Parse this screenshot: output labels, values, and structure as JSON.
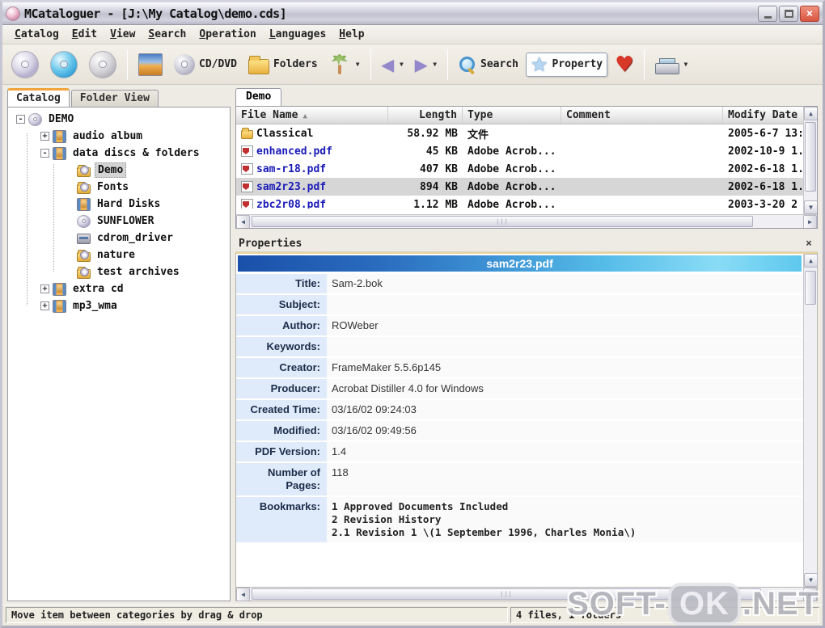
{
  "window": {
    "title": "MCataloguer - [J:\\My Catalog\\demo.cds]"
  },
  "menu": {
    "items": [
      "Catalog",
      "Edit",
      "View",
      "Search",
      "Operation",
      "Languages",
      "Help"
    ]
  },
  "toolbar": {
    "cd_dvd_label": "CD/DVD",
    "folders_label": "Folders",
    "search_label": "Search",
    "property_label": "Property"
  },
  "icons": {
    "dropdown": "▼",
    "back": "◀",
    "forward": "▶",
    "star": "★",
    "heart": "♥",
    "close": "×",
    "sort_ascending": "▲",
    "scroll_up": "▲",
    "scroll_down": "▼",
    "scroll_left": "◀",
    "scroll_right": "▶",
    "thumb_grip": "|||"
  },
  "left_panel": {
    "tabs": [
      {
        "label": "Catalog",
        "active": true
      },
      {
        "label": "Folder View",
        "active": false
      }
    ],
    "tree": [
      {
        "label": "DEMO",
        "level": 0,
        "expander": "-",
        "icon": "cd",
        "selected": false
      },
      {
        "label": "audio album",
        "level": 1,
        "expander": "+",
        "icon": "category",
        "selected": false
      },
      {
        "label": "data discs & folders",
        "level": 1,
        "expander": "-",
        "icon": "category",
        "selected": false
      },
      {
        "label": "Demo",
        "level": 2,
        "expander": "",
        "icon": "folderdisc",
        "selected": true
      },
      {
        "label": "Fonts",
        "level": 2,
        "expander": "",
        "icon": "folderdisc",
        "selected": false
      },
      {
        "label": "Hard Disks",
        "level": 2,
        "expander": "",
        "icon": "category",
        "selected": false
      },
      {
        "label": "SUNFLOWER",
        "level": 2,
        "expander": "",
        "icon": "cd",
        "selected": false
      },
      {
        "label": "cdrom_driver",
        "level": 2,
        "expander": "",
        "icon": "drive",
        "selected": false
      },
      {
        "label": "nature",
        "level": 2,
        "expander": "",
        "icon": "folderdisc",
        "selected": false
      },
      {
        "label": "test archives",
        "level": 2,
        "expander": "",
        "icon": "folderdisc",
        "selected": false
      },
      {
        "label": "extra cd",
        "level": 1,
        "expander": "+",
        "icon": "category",
        "selected": false
      },
      {
        "label": "mp3_wma",
        "level": 1,
        "expander": "+",
        "icon": "category",
        "selected": false
      }
    ]
  },
  "file_panel": {
    "tab": "Demo",
    "columns": [
      "File Name",
      "Length",
      "Type",
      "Comment",
      "Modify Date"
    ],
    "sorted_by": "File Name",
    "rows": [
      {
        "icon": "folder",
        "name": "Classical",
        "length": "58.92 MB",
        "type": "文件",
        "comment": "",
        "modify_date": "2005-6-7 13:",
        "selected": false
      },
      {
        "icon": "pdf",
        "name": "enhanced.pdf",
        "length": "45 KB",
        "type": "Adobe Acrob...",
        "comment": "",
        "modify_date": "2002-10-9 1.",
        "selected": false
      },
      {
        "icon": "pdf",
        "name": "sam-r18.pdf",
        "length": "407 KB",
        "type": "Adobe Acrob...",
        "comment": "",
        "modify_date": "2002-6-18 1.",
        "selected": false
      },
      {
        "icon": "pdf",
        "name": "sam2r23.pdf",
        "length": "894 KB",
        "type": "Adobe Acrob...",
        "comment": "",
        "modify_date": "2002-6-18 1.",
        "selected": true
      },
      {
        "icon": "pdf",
        "name": "zbc2r08.pdf",
        "length": "1.12 MB",
        "type": "Adobe Acrob...",
        "comment": "",
        "modify_date": "2003-3-20 2",
        "selected": false
      }
    ]
  },
  "properties_panel": {
    "title": "Properties",
    "banner": "sam2r23.pdf",
    "fields": [
      {
        "label": "Title:",
        "value": "Sam-2.bok",
        "mono": false
      },
      {
        "label": "Subject:",
        "value": "",
        "mono": false
      },
      {
        "label": "Author:",
        "value": "ROWeber",
        "mono": false
      },
      {
        "label": "Keywords:",
        "value": "",
        "mono": false
      },
      {
        "label": "Creator:",
        "value": "FrameMaker 5.5.6p145",
        "mono": false
      },
      {
        "label": "Producer:",
        "value": "Acrobat Distiller 4.0 for Windows",
        "mono": false
      },
      {
        "label": "Created Time:",
        "value": "03/16/02 09:24:03",
        "mono": false
      },
      {
        "label": "Modified:",
        "value": "03/16/02 09:49:56",
        "mono": false
      },
      {
        "label": "PDF Version:",
        "value": "1.4",
        "mono": false
      },
      {
        "label": "Number of Pages:",
        "value": "118",
        "mono": false
      },
      {
        "label": "Bookmarks:",
        "value": "",
        "mono": true,
        "lines": [
          "1 Approved Documents Included",
          "2 Revision History",
          " 2.1 Revision 1 \\(1 September 1996, Charles Monia\\)"
        ]
      }
    ]
  },
  "status_bar": {
    "left": "Move item between categories by drag & drop",
    "right": "4 files, 1 folders"
  },
  "watermark": {
    "part1": "SOFT-",
    "part2": "OK",
    "part3": ".NET"
  },
  "colors": {
    "banner_gradient_start": "#1a50aa",
    "banner_gradient_end": "#5ec8ee",
    "active_tab_accent": "#f0a43c",
    "pdf_link_blue": "#1a1ab8",
    "selected_row_gray": "#d6d6d6",
    "close_button_red": "#d85540",
    "prop_label_bg": "#dfeafa"
  }
}
